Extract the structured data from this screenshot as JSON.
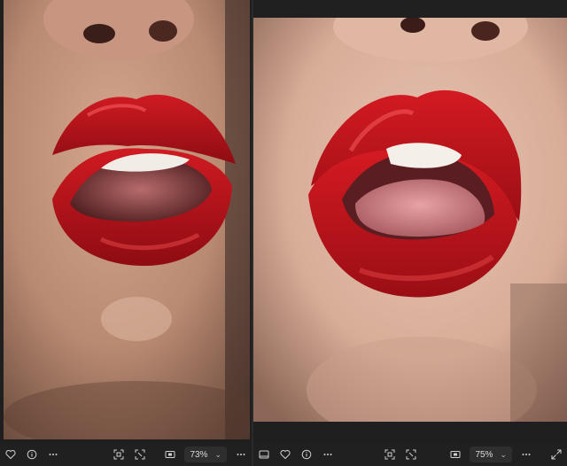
{
  "left_viewer": {
    "zoom_level": "73%",
    "toolbar_icons": [
      "favorite-icon",
      "info-icon",
      "more-icon",
      "crop-icon",
      "select-icon",
      "fit-icon",
      "more-icon"
    ]
  },
  "right_viewer": {
    "zoom_level": "75%",
    "toolbar_icons": [
      "filmstrip-icon",
      "favorite-icon",
      "info-icon",
      "more-icon",
      "crop-icon",
      "select-icon",
      "fit-icon",
      "more-icon",
      "fullscreen-icon"
    ]
  },
  "colors": {
    "lip_red": "#c0141c",
    "toolbar_bg": "#202020",
    "skin_left": "#c79a82",
    "skin_right": "#ddb8a6"
  }
}
